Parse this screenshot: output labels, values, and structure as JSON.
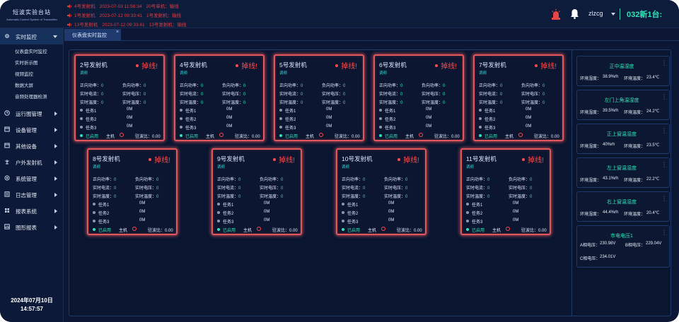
{
  "app": {
    "title_cn": "短波实验台站",
    "title_en": "Automatic Control System of Transmitter"
  },
  "alarms": [
    {
      "a": "4号发射机",
      "t": "2023-07-03 11:56:34",
      "b": "20号单机：输线"
    },
    {
      "a": "1号发射机",
      "t": "2023-07-12 09:33:41",
      "b": "1号发射机：输线"
    },
    {
      "a": "13号发射机",
      "t": "2023-07-12 09:33:41",
      "b": "13号发射机：输线"
    }
  ],
  "header": {
    "user": "zlzcg",
    "station": "032新1台:"
  },
  "sidebar": {
    "items": [
      {
        "label": "实时监控",
        "icon": "gear-icon"
      },
      {
        "label": "运行图管理",
        "icon": "clock-icon"
      },
      {
        "label": "设备管理",
        "icon": "device-icon"
      },
      {
        "label": "其他设备",
        "icon": "device-icon"
      },
      {
        "label": "户外发射机",
        "icon": "antenna-icon"
      },
      {
        "label": "系统管理",
        "icon": "settings-icon"
      },
      {
        "label": "日志管理",
        "icon": "log-icon"
      },
      {
        "label": "报表系统",
        "icon": "grid-icon"
      },
      {
        "label": "图形报表",
        "icon": "chart-icon"
      }
    ],
    "sub": [
      "仪表盘实时监控",
      "实时折示图",
      "视频监控",
      "数据大屏",
      "音频处理器检测"
    ],
    "date": "2024年07月10日",
    "time": "14:57:57"
  },
  "tabs": [
    {
      "label": "仪表盘实时监控",
      "close": "×"
    }
  ],
  "labels": {
    "fwd": "正向功率：",
    "rev": "负向功率：",
    "cur": "实时电流：",
    "vol": "实时电压：",
    "tmp": "实时温度：",
    "tmp2": "实时温度：",
    "task1": "任务1",
    "task2": "任务2",
    "task3": "任务3",
    "enabled": "已启用",
    "host": "主机",
    "vswr": "驻波比："
  },
  "transmitters": [
    {
      "name": "2号发射机",
      "mode": "调频",
      "status": "掉线!",
      "fwd": "0",
      "rev": "0",
      "cur": "0",
      "vol": "0",
      "tmp": "0",
      "tmp2": "0",
      "t1": "0M",
      "t2": "0M",
      "t3": "0M",
      "vswr": "0.00"
    },
    {
      "name": "4号发射机",
      "mode": "调频",
      "status": "掉线!",
      "fwd": "0",
      "rev": "0",
      "cur": "0",
      "vol": "0",
      "tmp": "0",
      "tmp2": "0",
      "t1": "0M",
      "t2": "0M",
      "t3": "0M",
      "vswr": "0.00"
    },
    {
      "name": "5号发射机",
      "mode": "调频",
      "status": "掉线!",
      "fwd": "0",
      "rev": "0",
      "cur": "0",
      "vol": "0",
      "tmp": "0",
      "tmp2": "0",
      "t1": "0M",
      "t2": "0M",
      "t3": "0M",
      "vswr": "0.00"
    },
    {
      "name": "6号发射机",
      "mode": "调频",
      "status": "掉线!",
      "fwd": "0",
      "rev": "0",
      "cur": "0",
      "vol": "0",
      "tmp": "0",
      "tmp2": "0",
      "t1": "0M",
      "t2": "0M",
      "t3": "0M",
      "vswr": "0.00"
    },
    {
      "name": "7号发射机",
      "mode": "调频",
      "status": "掉线!",
      "fwd": "0",
      "rev": "0",
      "cur": "0",
      "vol": "0",
      "tmp": "0",
      "tmp2": "0",
      "t1": "0M",
      "t2": "0M",
      "t3": "0M",
      "vswr": "0.00"
    },
    {
      "name": "8号发射机",
      "mode": "调频",
      "status": "掉线!",
      "fwd": "0",
      "rev": "0",
      "cur": "0",
      "vol": "0",
      "tmp": "0",
      "tmp2": "0",
      "t1": "0M",
      "t2": "0M",
      "t3": "0M",
      "vswr": "0.00"
    },
    {
      "name": "9号发射机",
      "mode": "调频",
      "status": "掉线!",
      "fwd": "0",
      "rev": "0",
      "cur": "0",
      "vol": "0",
      "tmp": "0",
      "tmp2": "0",
      "t1": "0M",
      "t2": "0M",
      "t3": "0M",
      "vswr": "0.00"
    },
    {
      "name": "10号发射机",
      "mode": "调频",
      "status": "掉线!",
      "fwd": "0",
      "rev": "0",
      "cur": "0",
      "vol": "0",
      "tmp": "0",
      "tmp2": "0",
      "t1": "0M",
      "t2": "0M",
      "t3": "0M",
      "vswr": "0.00"
    },
    {
      "name": "11号发射机",
      "mode": "调频",
      "status": "掉线!",
      "fwd": "0",
      "rev": "0",
      "cur": "0",
      "vol": "0",
      "tmp": "0",
      "tmp2": "0",
      "t1": "0M",
      "t2": "0M",
      "t3": "0M",
      "vswr": "0.00"
    }
  ],
  "env": [
    {
      "title": "正中温湿度",
      "k1": "环境湿度：",
      "v1": "38.9%rh",
      "k2": "环境温度：",
      "v2": "23.4℃"
    },
    {
      "title": "左门上角温湿度",
      "k1": "环境湿度：",
      "v1": "39.5%rh",
      "k2": "环境温度：",
      "v2": "24.2℃"
    },
    {
      "title": "正上窗温湿度",
      "k1": "环境湿度：",
      "v1": "40%rh",
      "k2": "环境温度：",
      "v2": "23.5℃"
    },
    {
      "title": "左上窗温湿度",
      "k1": "环境湿度：",
      "v1": "43.1%rh",
      "k2": "环境温度：",
      "v2": "22.2℃"
    },
    {
      "title": "右上窗温湿度",
      "k1": "环境湿度：",
      "v1": "44.4%rh",
      "k2": "环境温度：",
      "v2": "20.4℃"
    }
  ],
  "power": {
    "title": "市电电压1",
    "k1": "A相电压：",
    "v1": "230.98V",
    "k2": "B相电压：",
    "v2": "229.04V",
    "k3": "C相电压：",
    "v3": "234.01V"
  },
  "colors": {
    "accent": "#2ee7b6",
    "alarm": "#ff4b4b",
    "card_border": "#e2575c",
    "bg": "#0b1734"
  }
}
